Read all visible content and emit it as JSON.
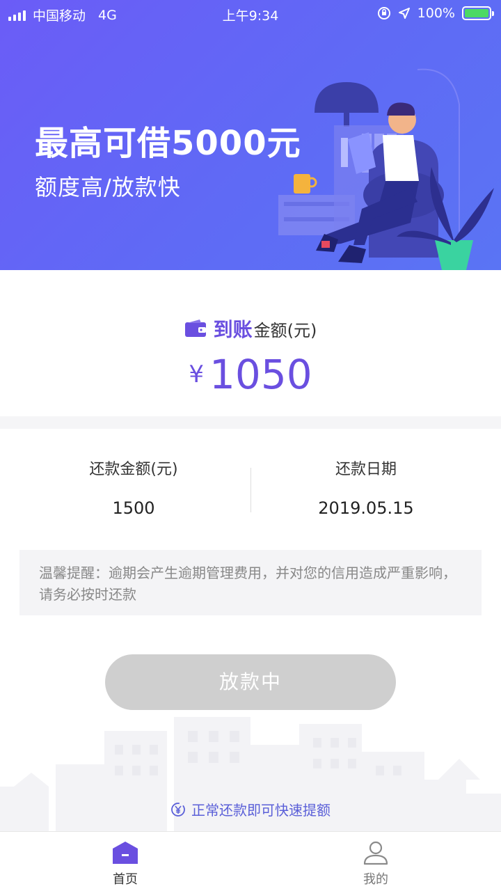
{
  "status_bar": {
    "carrier": "中国移动",
    "network": "4G",
    "time": "上午9:34",
    "battery": "100%"
  },
  "banner": {
    "headline": "最高可借5000元",
    "subline": "额度高/放款快"
  },
  "amount": {
    "title_strong": "到账",
    "title_rest": "金额(元)",
    "currency": "¥",
    "value": "1050"
  },
  "repayment": {
    "amount_label": "还款金额(元)",
    "amount_value": "1500",
    "date_label": "还款日期",
    "date_value": "2019.05.15"
  },
  "notice": "温馨提醒：逾期会产生逾期管理费用，并对您的信用造成严重影响，请务必按时还款",
  "button_label": "放款中",
  "tip": "正常还款即可快速提额",
  "tabs": [
    {
      "label": "首页",
      "icon": "home-icon",
      "active": true
    },
    {
      "label": "我的",
      "icon": "user-icon",
      "active": false
    }
  ],
  "colors": {
    "accent": "#6a4fe0",
    "banner_start": "#6b5cf7",
    "banner_end": "#5a74f4",
    "button_disabled": "#cfcfcf",
    "battery": "#4cd964"
  }
}
